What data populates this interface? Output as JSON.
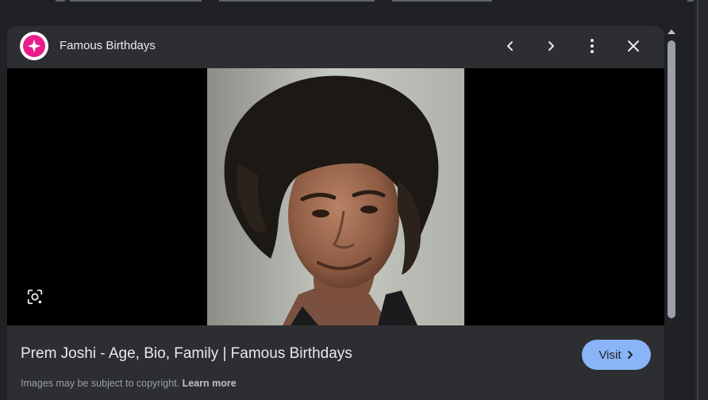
{
  "source": {
    "site_name": "Famous Birthdays",
    "logo_icon": "sparkle-star-icon",
    "logo_color": "#e91e8c"
  },
  "header": {
    "prev_icon": "chevron-left-icon",
    "next_icon": "chevron-right-icon",
    "more_icon": "more-vertical-icon",
    "close_icon": "close-icon"
  },
  "image": {
    "subject": "portrait photo",
    "lens_icon": "google-lens-icon"
  },
  "result": {
    "title": "Prem Joshi - Age, Bio, Family | Famous Birthdays",
    "visit_label": "Visit",
    "visit_color": "#8ab4f8"
  },
  "footer": {
    "copyright_text": "Images may be subject to copyright.",
    "learn_more": "Learn more"
  },
  "colors": {
    "background": "#202124",
    "panel": "#2d2e31",
    "text": "#e8eaed",
    "muted": "#9aa0a6"
  }
}
